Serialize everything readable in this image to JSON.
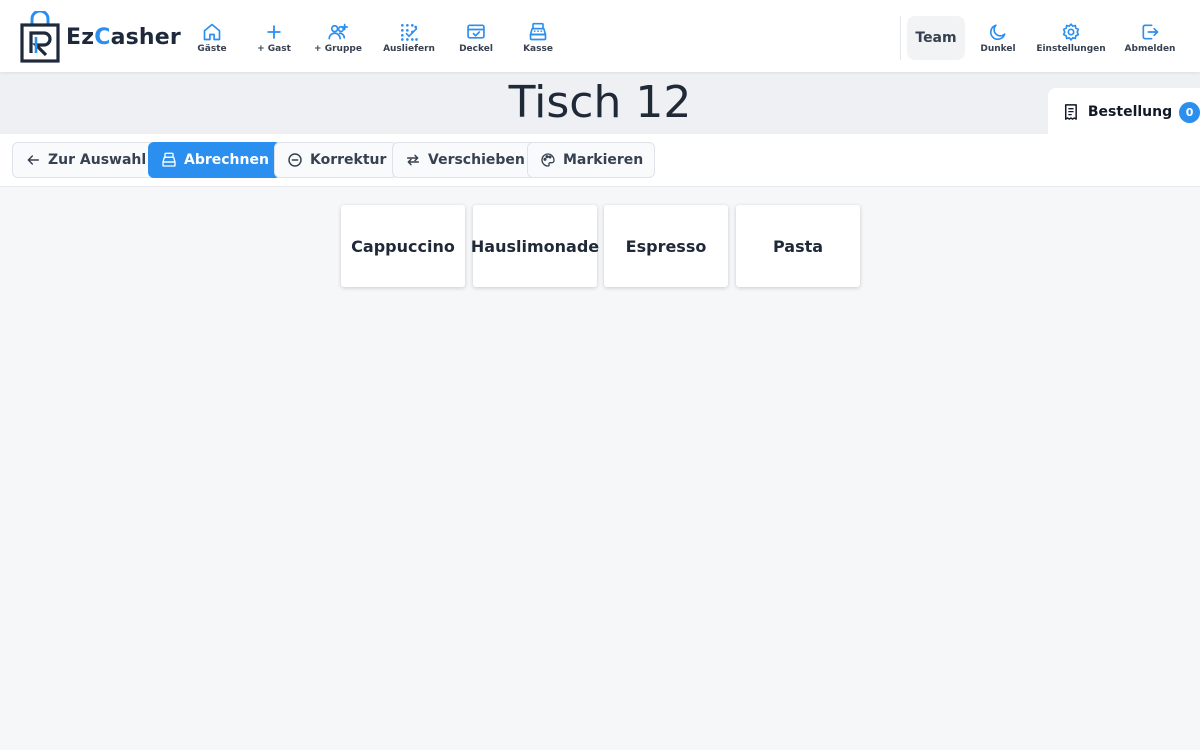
{
  "app": {
    "logo_prefix": "Ez",
    "logo_accent": "C",
    "logo_suffix": "asher",
    "accent_color": "#2b8ff0"
  },
  "nav": {
    "items": [
      {
        "label": "Gäste",
        "icon": "home-icon"
      },
      {
        "label": "+ Gast",
        "icon": "plus-icon"
      },
      {
        "label": "+ Gruppe",
        "icon": "user-group-add-icon"
      },
      {
        "label": "Ausliefern",
        "icon": "dots-grid-icon"
      },
      {
        "label": "Deckel",
        "icon": "card-icon"
      },
      {
        "label": "Kasse",
        "icon": "cash-register-icon"
      }
    ],
    "team_label": "Team",
    "right_items": [
      {
        "label": "Dunkel",
        "icon": "moon-icon"
      },
      {
        "label": "Einstellungen",
        "icon": "gear-icon"
      },
      {
        "label": "Abmelden",
        "icon": "logout-icon"
      }
    ]
  },
  "page": {
    "title": "Tisch 12",
    "order_tab": {
      "label": "Bestellung",
      "count": "0",
      "icon": "receipt-icon"
    }
  },
  "toolbar": {
    "buttons": [
      {
        "label": "Zur Auswahl",
        "icon": "arrow-left-icon"
      },
      {
        "label": "Abrechnen",
        "icon": "cash-register-icon",
        "primary": true
      },
      {
        "label": "Korrektur",
        "icon": "minus-circle-icon"
      },
      {
        "label": "Verschieben",
        "icon": "swap-arrows-icon"
      },
      {
        "label": "Markieren",
        "icon": "palette-icon"
      }
    ]
  },
  "items": [
    {
      "name": "Cappuccino"
    },
    {
      "name": "Hauslimonade"
    },
    {
      "name": "Espresso"
    },
    {
      "name": "Pasta"
    }
  ]
}
